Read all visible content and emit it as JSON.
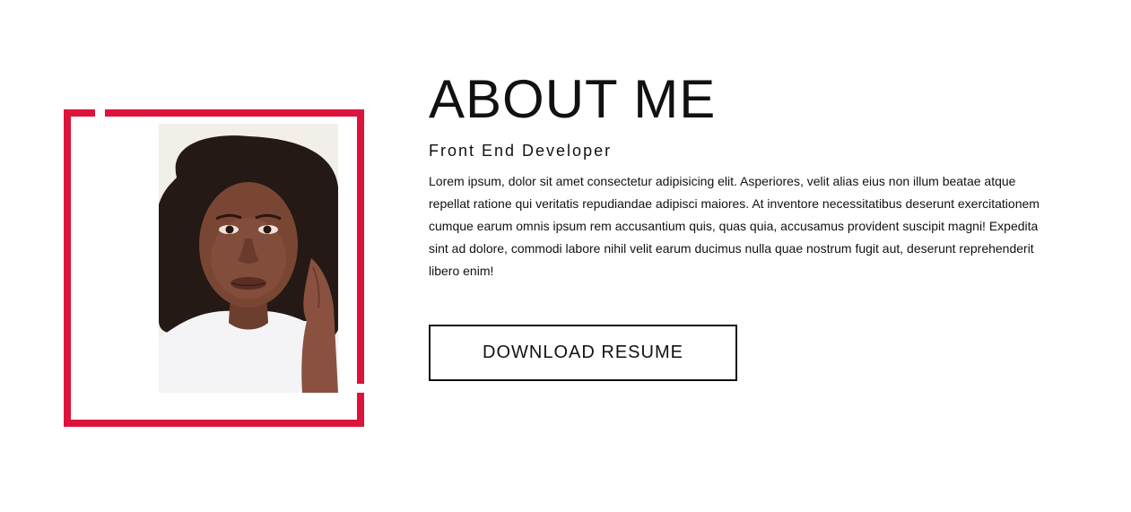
{
  "about": {
    "heading": "ABOUT ME",
    "role": "Front End Developer",
    "bio": "Lorem ipsum, dolor sit amet consectetur adipisicing elit. Asperiores, velit alias eius non illum beatae atque repellat ratione qui veritatis repudiandae adipisci maiores. At inventore necessitatibus deserunt exercitationem cumque earum omnis ipsum rem accusantium quis, quas quia, accusamus provident suscipit magni! Expedita sint ad dolore, commodi labore nihil velit earum ducimus nulla quae nostrum fugit aut, deserunt reprehenderit libero enim!",
    "download_label": "DOWNLOAD RESUME"
  },
  "colors": {
    "accent": "#dc143c",
    "text": "#111111",
    "background": "#ffffff"
  }
}
